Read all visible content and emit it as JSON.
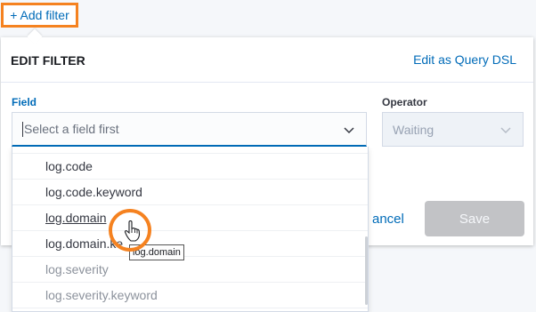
{
  "add_filter": {
    "label": "+ Add filter"
  },
  "popover": {
    "title": "EDIT FILTER",
    "edit_dsl_link": "Edit as Query DSL",
    "field": {
      "label": "Field",
      "placeholder": "Select a field first"
    },
    "operator": {
      "label": "Operator",
      "value": "Waiting"
    },
    "cancel_label": "ancel",
    "save_label": "Save"
  },
  "dropdown": {
    "items": [
      {
        "label": "log.code"
      },
      {
        "label": "log.code.keyword"
      },
      {
        "label": "log.domain"
      },
      {
        "label": "log.domain.ke"
      },
      {
        "label": "log.severity"
      },
      {
        "label": "log.severity.keyword"
      }
    ]
  },
  "tooltip": {
    "text": "log.domain"
  },
  "colors": {
    "accent": "#f58220",
    "link": "#006bb8",
    "save_disabled": "#c2c3c6"
  },
  "icons": [
    "chevron-down-icon",
    "pointer-hand-icon"
  ]
}
